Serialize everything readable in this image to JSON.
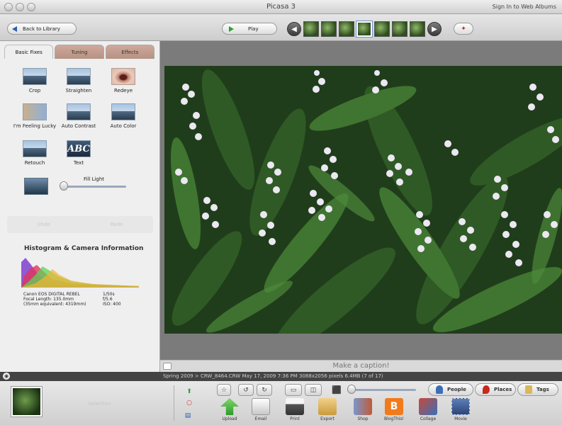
{
  "window": {
    "title": "Picasa 3",
    "signin": "Sign In to Web Albums"
  },
  "toolbar": {
    "back_label": "Back to Library",
    "play_label": "Play"
  },
  "tabs": [
    {
      "label": "Basic Fixes",
      "active": true
    },
    {
      "label": "Tuning",
      "active": false
    },
    {
      "label": "Effects",
      "active": false
    }
  ],
  "tools": {
    "crop": "Crop",
    "straighten": "Straighten",
    "redeye": "Redeye",
    "lucky": "I'm Feeling Lucky",
    "auto_contrast": "Auto Contrast",
    "auto_color": "Auto Color",
    "retouch": "Retouch",
    "text": "Text",
    "text_icon": "ABC",
    "fill_light": "Fill Light"
  },
  "faded": {
    "undo": "Undo",
    "redo": "Redo"
  },
  "histogram": {
    "title": "Histogram & Camera Information",
    "camera": "Canon EOS DIGITAL REBEL",
    "focal": "Focal Length: 135.0mm",
    "equiv": "(35mm equivalent: 4319mm)",
    "shutter": "1/50s",
    "aperture": "f/5.6",
    "iso": "ISO: 400"
  },
  "caption": {
    "placeholder": "Make a caption!"
  },
  "status": {
    "text": "Spring 2009 > CRW_8464.CRW    May 17, 2009 7:36 PM    3088x2056 pixels    6.4MB    (7 of 17)"
  },
  "tray": {
    "selection": "Selection",
    "people": "People",
    "places": "Places",
    "tags": "Tags",
    "actions": [
      "Upload",
      "Email",
      "Print",
      "Export",
      "Shop",
      "BlogThis!",
      "Collage",
      "Movie"
    ]
  },
  "colors": {
    "accent_blue": "#2a5fb2",
    "play_green": "#2ea02e",
    "tab_rose": "#c4a193",
    "photo_green": "#2f5a25"
  }
}
